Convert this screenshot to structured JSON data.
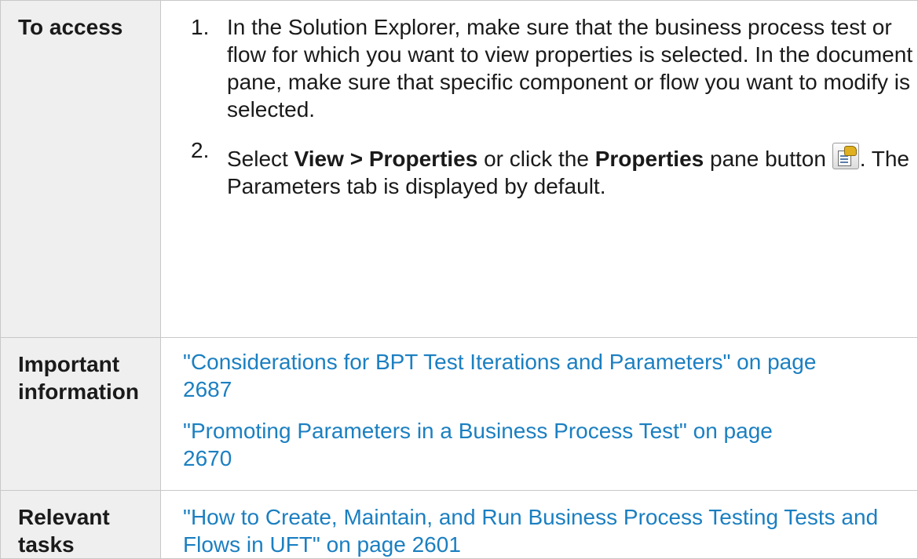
{
  "rows": {
    "access": {
      "header": "To access",
      "step1": {
        "number": "1.",
        "text": "In the Solution Explorer, make sure that the business process test or flow for which you want to view properties is selected. In the document pane, make sure that specific component or flow you want to modify is selected."
      },
      "step2": {
        "number": "2.",
        "select": "Select ",
        "menu_path": "View > Properties",
        "or_click": " or click the ",
        "pane_name": "Properties",
        "pane_button": " pane button ",
        "icon": "properties-pane-icon",
        "suffix": ". The Parameters tab is displayed by default."
      }
    },
    "important": {
      "header_line1": "Important",
      "header_line2": "information",
      "link1": "\"Considerations for BPT Test Iterations and Parameters\" on page 2687",
      "link2": "\"Promoting Parameters in a Business Process Test\" on page 2670"
    },
    "tasks": {
      "header_line1": "Relevant",
      "header_line2": "tasks",
      "link1": "\"How to Create, Maintain, and Run Business Process Testing Tests and Flows in UFT\" on page 2601"
    }
  },
  "colors": {
    "link": "#1b7fc1",
    "header_bg": "#efefef",
    "border": "#c8c8c8"
  }
}
